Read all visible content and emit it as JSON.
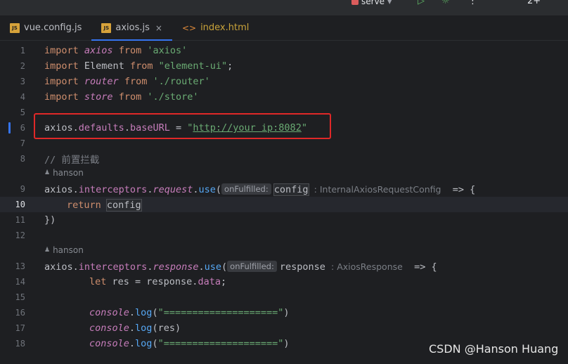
{
  "toolbar": {
    "run_config_label": "serve",
    "play_icon": "▷",
    "debug_icon": "☼",
    "more_icon": "⋮",
    "add_icon": "2+"
  },
  "tabs": [
    {
      "label": "vue.config.js",
      "type": "js",
      "active": false
    },
    {
      "label": "axios.js",
      "type": "js",
      "active": true,
      "close": "×"
    },
    {
      "label": "index.html",
      "type": "html",
      "active": false
    }
  ],
  "badges": {
    "js": "JS",
    "html": "<>"
  },
  "editor": {
    "lines": {
      "l1": "1",
      "l2": "2",
      "l3": "3",
      "l4": "4",
      "l5": "5",
      "l6": "6",
      "l7": "7",
      "l8": "8",
      "l9": "9",
      "l10": "10",
      "l11": "11",
      "l12": "12",
      "l13": "13",
      "l14": "14",
      "l15": "15",
      "l16": "16",
      "l17": "17",
      "l18": "18"
    },
    "current_line": 10,
    "imports": [
      {
        "kw": "import",
        "name": "axios",
        "from": "from",
        "path": "'axios'"
      },
      {
        "kw": "import",
        "name": "Element",
        "from": "from",
        "path": "\"element-ui\"",
        "end": ";"
      },
      {
        "kw": "import",
        "name": "router",
        "from": "from",
        "path": "'./router'"
      },
      {
        "kw": "import",
        "name": "store",
        "from": "from",
        "path": "'./store'"
      }
    ],
    "baseurl": {
      "obj": "axios",
      "dot1": ".",
      "p1": "defaults",
      "dot2": ".",
      "p2": "baseURL",
      "eq": " = ",
      "q1": "\"",
      "url": "http://your ip:8082",
      "q2": "\""
    },
    "comment": "// 前置拦截",
    "author": "hanson",
    "request": {
      "obj": "axios",
      "p1": "interceptors",
      "p2": "request",
      "fn": "use",
      "open": "(",
      "hint": "onFulfilled:",
      "param": "config",
      "type": ": InternalAxiosRequestConfig",
      "arrow": "=> {"
    },
    "return_kw": "return",
    "return_val": "config",
    "close_brace": "})",
    "response": {
      "obj": "axios",
      "p1": "interceptors",
      "p2": "response",
      "fn": "use",
      "open": "(",
      "hint": "onFulfilled:",
      "param": "response",
      "type": ": AxiosResponse",
      "arrow": "=> {"
    },
    "let_line": {
      "kw": "let",
      "rest": " res = response.",
      "prop": "data",
      "end": ";"
    },
    "console_obj": "console",
    "log_fn": "log",
    "sep_string": "\"====================\"",
    "res_arg": "res"
  },
  "watermark": "CSDN @Hanson Huang",
  "colors": {
    "accent": "#3574f0",
    "highlight_box": "#e02828",
    "keyword": "#cf8e6d",
    "string": "#6aab73"
  }
}
